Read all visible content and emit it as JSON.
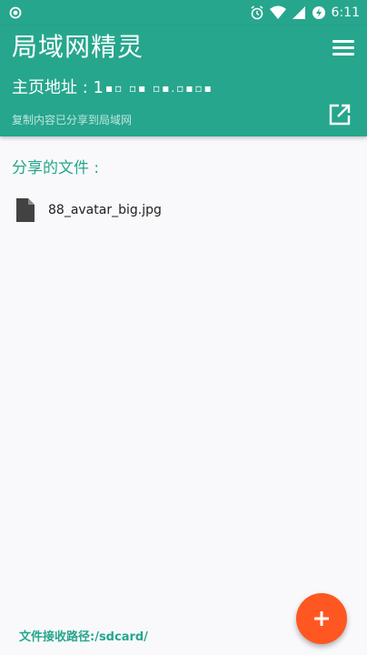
{
  "status_bar": {
    "time": "6:11"
  },
  "app_bar": {
    "title": "局域网精灵",
    "address_label": "主页地址 : 1",
    "address_masked": "▪▫ ▫▪ ▫▪.▫▪▫▪",
    "copy_hint": "复制内容已分享到局域网"
  },
  "shared_files": {
    "title": "分享的文件 :",
    "items": [
      {
        "name": "88_avatar_big.jpg"
      }
    ]
  },
  "receive_path": "文件接收路径:/sdcard/",
  "colors": {
    "primary": "#26a68d",
    "fab": "#ff5722"
  },
  "icons": {
    "status_left": "camera-dot-icon",
    "menu": "hamburger-menu-icon",
    "open_external": "open-external-icon",
    "file": "file-icon",
    "fab": "plus-icon"
  }
}
